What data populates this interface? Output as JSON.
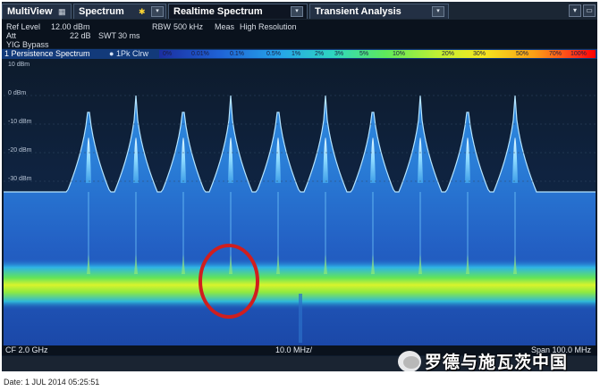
{
  "tabs": {
    "multiview": "MultiView",
    "spectrum": "Spectrum",
    "realtime": "Realtime Spectrum",
    "transient": "Transient Analysis"
  },
  "window_controls": {
    "minimize_label": "▾",
    "split_label": "▭"
  },
  "settings": {
    "ref_level_label": "Ref Level",
    "ref_level_value": "12.00 dBm",
    "att_label": "Att",
    "att_value": "22 dB",
    "swt_label": "SWT",
    "swt_value": "30 ms",
    "yig_label": "YIG Bypass",
    "rbw_label": "RBW",
    "rbw_value": "500 kHz",
    "meas_label": "Meas",
    "meas_value": "High Resolution"
  },
  "trace": {
    "title": "1 Persistence Spectrum",
    "detector": "1Pk Clrw"
  },
  "persistence_scale": [
    "0%",
    "0.01%",
    "0.1%",
    "0.5%",
    "1%",
    "2%",
    "3%",
    "5%",
    "10%",
    "20%",
    "30%",
    "50%",
    "70%",
    "100%"
  ],
  "y_axis_labels": [
    "10 dBm",
    "0 dBm",
    "-10 dBm",
    "-20 dBm",
    "-30 dBm"
  ],
  "footer": {
    "cf": "CF 2.0 GHz",
    "div": "10.0 MHz/",
    "span": "Span 100.0 MHz"
  },
  "date": "Date: 1 JUL 2014  05:25:51",
  "watermark": "罗德与施瓦茨中国",
  "colors": {
    "background": "#0d1b2c",
    "trace_blue": "#2a6fd8",
    "persistence_green": "#7cf03c",
    "highlight_circle": "#d01e1e"
  }
}
